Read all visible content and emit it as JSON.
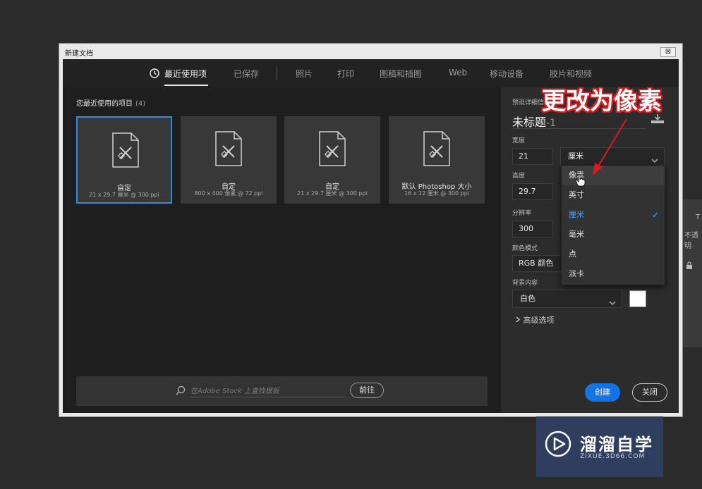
{
  "window": {
    "title": "新建文档",
    "close_glyph": "⊠"
  },
  "tabs": [
    {
      "label": "最近使用项",
      "active": true,
      "icon": "clock-icon"
    },
    {
      "label": "已保存"
    },
    {
      "label": "照片"
    },
    {
      "label": "打印"
    },
    {
      "label": "图稿和插图"
    },
    {
      "label": "Web"
    },
    {
      "label": "移动设备"
    },
    {
      "label": "胶片和视频"
    }
  ],
  "recent": {
    "heading": "您最近使用的项目",
    "count": "(4)",
    "items": [
      {
        "title": "自定",
        "subtitle": "21 x 29.7 厘米 @ 300 ppi",
        "selected": true
      },
      {
        "title": "自定",
        "subtitle": "800 x 400 像素 @ 72 ppi"
      },
      {
        "title": "自定",
        "subtitle": "21 x 29.7 厘米 @ 300 ppi"
      },
      {
        "title": "默认 Photoshop 大小",
        "subtitle": "16 x 12 厘米 @ 300 ppi"
      }
    ]
  },
  "stock": {
    "placeholder": "在Adobe Stock 上查找模板",
    "go_label": "前往"
  },
  "preset": {
    "heading": "预设详细信",
    "doc_title": "未标题",
    "doc_title_suffix": "-1",
    "width_label": "宽度",
    "width_value": "21",
    "unit_value": "厘米",
    "height_label": "高度",
    "height_value": "29.7",
    "resolution_label": "分辨率",
    "resolution_value": "300",
    "color_mode_label": "颜色模式",
    "color_mode_value": "RGB 颜色",
    "bg_label": "背景内容",
    "bg_value": "白色",
    "bg_swatch_color": "#ffffff",
    "advanced_label": "高级选项",
    "create_label": "创建",
    "close_label": "关闭"
  },
  "unit_dropdown": {
    "options": [
      "像素",
      "英寸",
      "厘米",
      "毫米",
      "点",
      "派卡"
    ],
    "hovered": "像素",
    "selected": "厘米"
  },
  "annotation": {
    "text": "更改为像素",
    "color": "#d91c22"
  },
  "background_app": {
    "text1": "不透明",
    "glyph": "T"
  },
  "watermark": {
    "name": "溜溜自学",
    "url": "ZIXUE.3D66.COM"
  },
  "colors": {
    "accent": "#1473e6",
    "selection_border": "#2d8ceb",
    "check": "#4aa3ff"
  }
}
